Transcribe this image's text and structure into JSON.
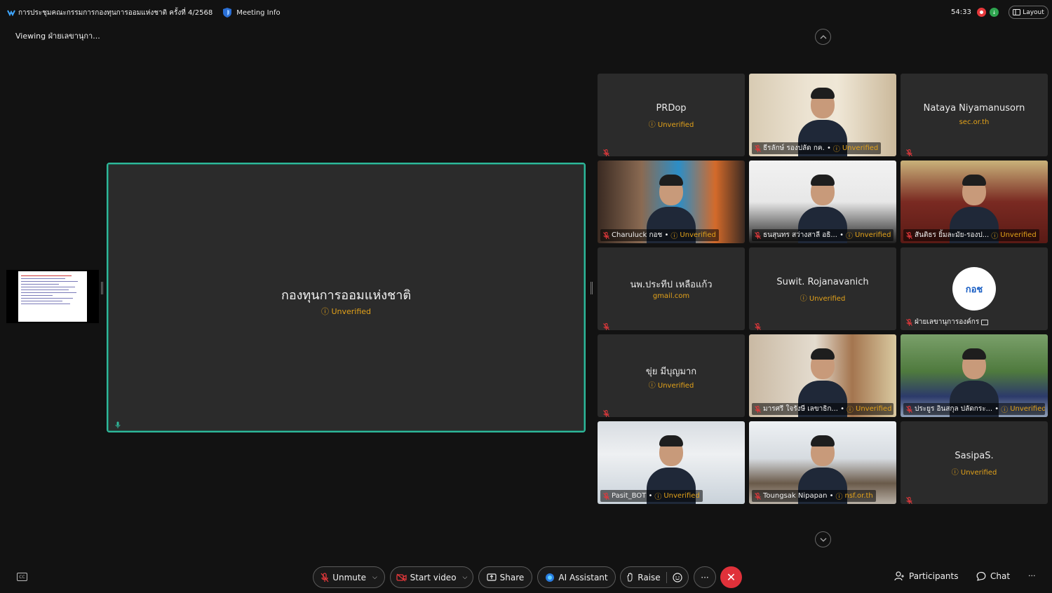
{
  "window": {
    "title": "การประชุมคณะกรรมการกองทุนการออมแห่งชาติ ครั้งที่ 4/2568",
    "meeting_info": "Meeting Info",
    "timer": "54:33",
    "enc_badge": "↓",
    "layout_label": "Layout"
  },
  "viewing": "Viewing ฝ่ายเลขานุกา...",
  "main_speaker": {
    "name": "กองทุนการออมแห่งชาติ",
    "status": "Unverified"
  },
  "tiles": [
    {
      "kind": "name",
      "name": "PRDop",
      "sub": "Unverified",
      "sub_verified": false
    },
    {
      "kind": "video",
      "label": "ธีรลักษ์ รองปลัด กค. •",
      "status": "Unverified",
      "scene": "man-office"
    },
    {
      "kind": "name",
      "name": "Nataya Niyamanusorn",
      "sub": "sec.or.th",
      "sub_verified": true
    },
    {
      "kind": "video",
      "label": "Charuluck กอช •",
      "status": "Unverified",
      "scene": "woman-blue"
    },
    {
      "kind": "video",
      "label": "ธนสุนทร สว่างสาลี อธิ... •",
      "status": "Unverified",
      "scene": "man-glasses"
    },
    {
      "kind": "video",
      "label": "สันติธร ยิ้มละมัย-รองป...",
      "status": "Unverified",
      "scene": "ornate-office"
    },
    {
      "kind": "name",
      "name": "นพ.ประทีป เหลือแก้ว",
      "sub": "gmail.com",
      "sub_verified": true
    },
    {
      "kind": "name",
      "name": "Suwit. Rojanavanich",
      "sub": "Unverified",
      "sub_verified": false
    },
    {
      "kind": "logo",
      "label": "ฝ่ายเลขานุการองค์กร",
      "logo_text": "กอช"
    },
    {
      "kind": "name",
      "name": "ขุ่ย  มีบุญมาก",
      "sub": "Unverified",
      "sub_verified": false
    },
    {
      "kind": "video",
      "label": "มารศรี  ใจรังษี เลขาธิก... •",
      "status": "Unverified",
      "scene": "woman-office"
    },
    {
      "kind": "video",
      "label": "ประยูร อินสกุล ปลัดกระ... •",
      "status": "Unverified",
      "scene": "man-outdoor"
    },
    {
      "kind": "video",
      "label": "Pasit_BOT •",
      "status": "Unverified",
      "scene": "young-man"
    },
    {
      "kind": "video",
      "label": "Toungsak Nipapan •",
      "status": "nsf.or.th",
      "scene": "meeting-room"
    },
    {
      "kind": "name",
      "name": "SasipaS.",
      "sub": "Unverified",
      "sub_verified": false
    }
  ],
  "controls": {
    "unmute": "Unmute",
    "start_video": "Start video",
    "share": "Share",
    "ai_assistant": "AI Assistant",
    "raise": "Raise",
    "more": "···",
    "end": "✕",
    "participants": "Participants",
    "chat": "Chat",
    "overflow": "···",
    "cc": "CC"
  },
  "colors": {
    "accent_active": "#2fb89a",
    "unverified": "#e3a21a",
    "end_call": "#e0313a"
  }
}
